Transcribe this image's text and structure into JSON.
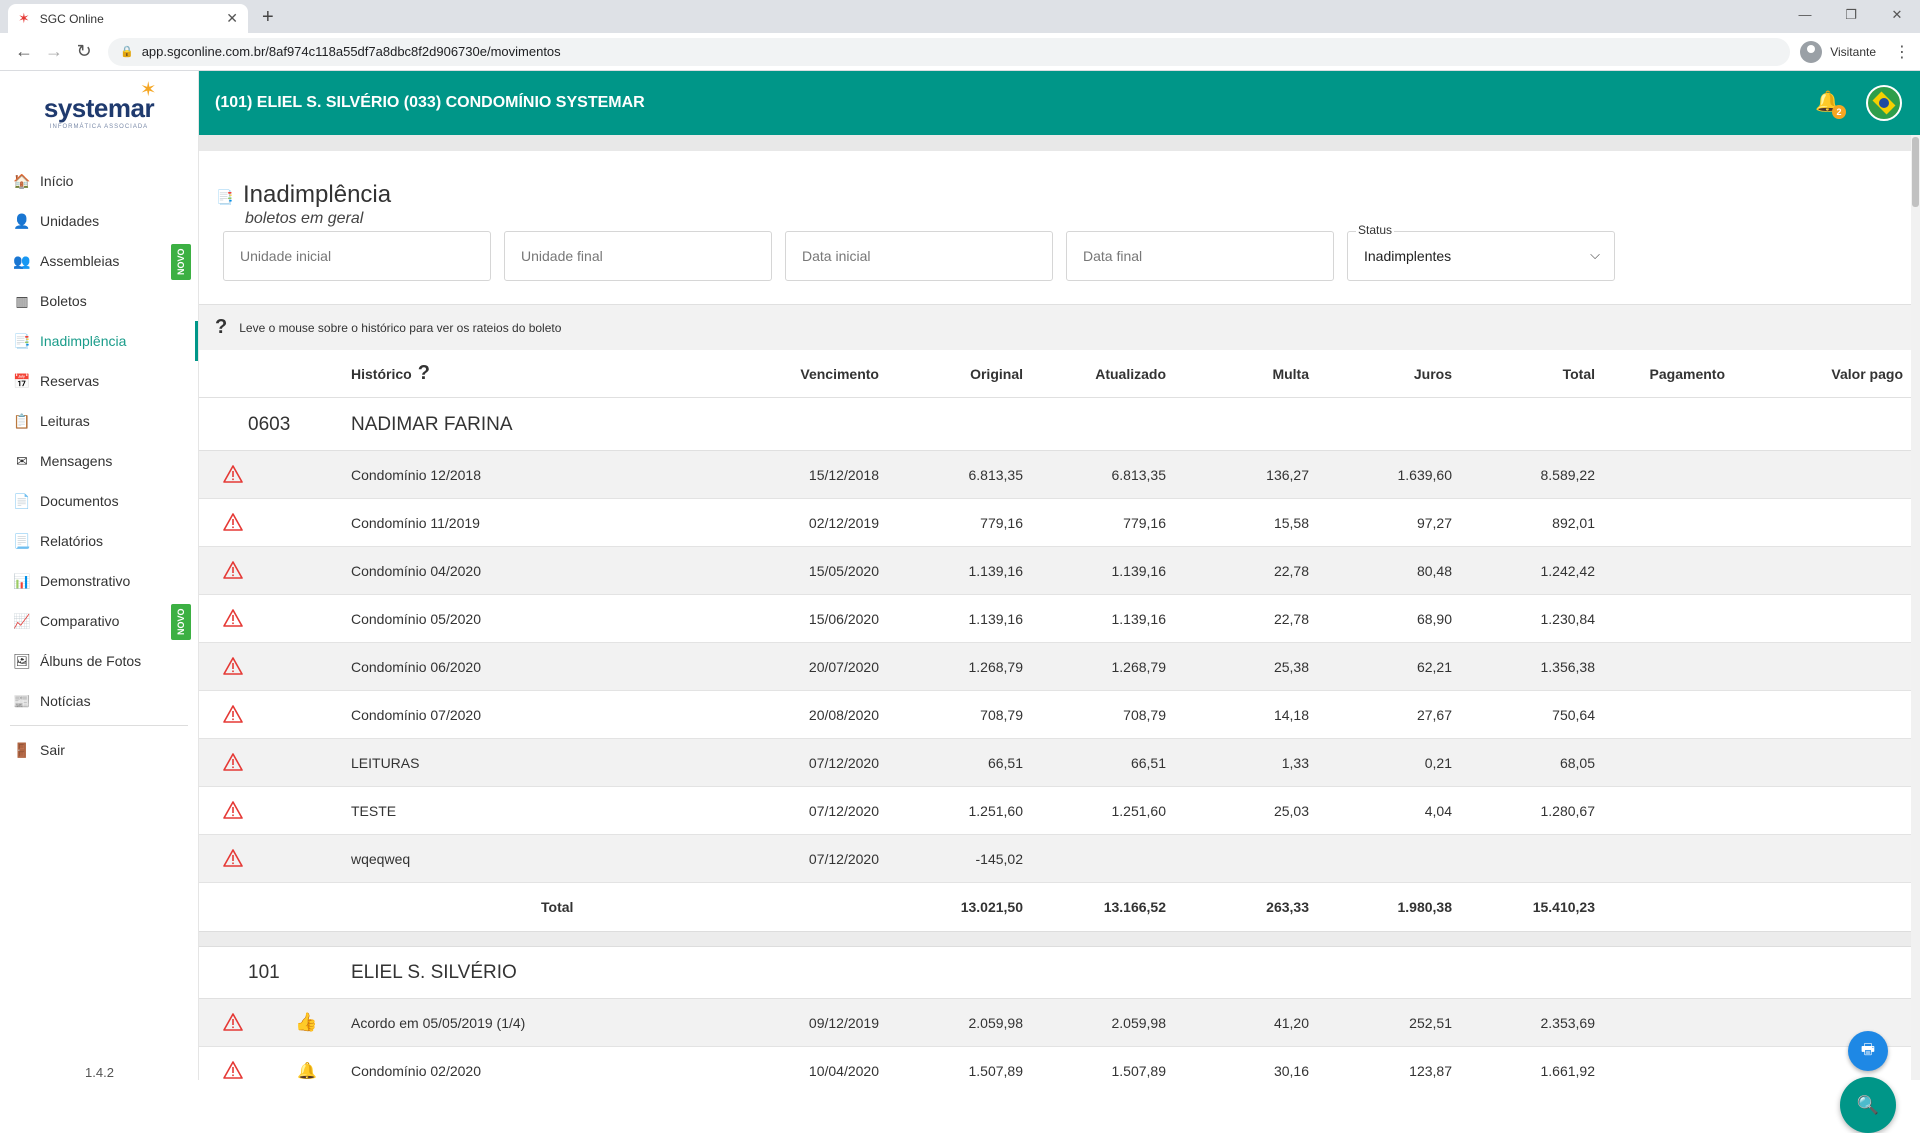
{
  "browser": {
    "tab_title": "SGC Online",
    "url": "app.sgconline.com.br/8af974c118a55df7a8dbc8f2d906730e/movimentos",
    "profile": "Visitante"
  },
  "logo": {
    "name": "systemar",
    "sub": "INFORMÁTICA ASSOCIADA"
  },
  "sidebar": {
    "items": [
      {
        "label": "Início",
        "icon": "home-icon"
      },
      {
        "label": "Unidades",
        "icon": "person-icon"
      },
      {
        "label": "Assembleias",
        "icon": "group-icon",
        "badge": "NOVO"
      },
      {
        "label": "Boletos",
        "icon": "barcode-icon"
      },
      {
        "label": "Inadimplência",
        "icon": "overdue-icon"
      },
      {
        "label": "Reservas",
        "icon": "calendar-icon"
      },
      {
        "label": "Leituras",
        "icon": "meter-icon"
      },
      {
        "label": "Mensagens",
        "icon": "message-icon"
      },
      {
        "label": "Documentos",
        "icon": "document-icon"
      },
      {
        "label": "Relatórios",
        "icon": "report-icon"
      },
      {
        "label": "Demonstrativo",
        "icon": "chart-icon"
      },
      {
        "label": "Comparativo",
        "icon": "compare-icon",
        "badge": "NOVO"
      },
      {
        "label": "Álbuns de Fotos",
        "icon": "photo-icon"
      },
      {
        "label": "Notícias",
        "icon": "news-icon"
      }
    ],
    "logout": "Sair",
    "version": "1.4.2"
  },
  "topbar": {
    "title": "(101) ELIEL S. SILVÉRIO  (033) CONDOMÍNIO SYSTEMAR",
    "notifications": "2"
  },
  "page": {
    "title": "Inadimplência",
    "subtitle": "boletos em geral"
  },
  "filters": {
    "unidade_inicial": "Unidade inicial",
    "unidade_final": "Unidade final",
    "data_inicial": "Data inicial",
    "data_final": "Data final",
    "status_label": "Status",
    "status_value": "Inadimplentes"
  },
  "hint": "Leve o mouse sobre o histórico para ver os rateios do boleto",
  "columns": {
    "historico": "Histórico",
    "vencimento": "Vencimento",
    "original": "Original",
    "atualizado": "Atualizado",
    "multa": "Multa",
    "juros": "Juros",
    "total": "Total",
    "pagamento": "Pagamento",
    "valor_pago": "Valor pago"
  },
  "groups": [
    {
      "code": "0603",
      "name": "NADIMAR FARINA",
      "rows": [
        {
          "historico": "Condomínio 12/2018",
          "vencimento": "15/12/2018",
          "original": "6.813,35",
          "atualizado": "6.813,35",
          "multa": "136,27",
          "juros": "1.639,60",
          "total": "8.589,22"
        },
        {
          "historico": "Condomínio 11/2019",
          "vencimento": "02/12/2019",
          "original": "779,16",
          "atualizado": "779,16",
          "multa": "15,58",
          "juros": "97,27",
          "total": "892,01"
        },
        {
          "historico": "Condomínio 04/2020",
          "vencimento": "15/05/2020",
          "original": "1.139,16",
          "atualizado": "1.139,16",
          "multa": "22,78",
          "juros": "80,48",
          "total": "1.242,42"
        },
        {
          "historico": "Condomínio 05/2020",
          "vencimento": "15/06/2020",
          "original": "1.139,16",
          "atualizado": "1.139,16",
          "multa": "22,78",
          "juros": "68,90",
          "total": "1.230,84"
        },
        {
          "historico": "Condomínio 06/2020",
          "vencimento": "20/07/2020",
          "original": "1.268,79",
          "atualizado": "1.268,79",
          "multa": "25,38",
          "juros": "62,21",
          "total": "1.356,38"
        },
        {
          "historico": "Condomínio 07/2020",
          "vencimento": "20/08/2020",
          "original": "708,79",
          "atualizado": "708,79",
          "multa": "14,18",
          "juros": "27,67",
          "total": "750,64"
        },
        {
          "historico": "LEITURAS",
          "vencimento": "07/12/2020",
          "original": "66,51",
          "atualizado": "66,51",
          "multa": "1,33",
          "juros": "0,21",
          "total": "68,05"
        },
        {
          "historico": "TESTE",
          "vencimento": "07/12/2020",
          "original": "1.251,60",
          "atualizado": "1.251,60",
          "multa": "25,03",
          "juros": "4,04",
          "total": "1.280,67"
        },
        {
          "historico": "wqeqweq",
          "vencimento": "07/12/2020",
          "original": "-145,02",
          "atualizado": "",
          "multa": "",
          "juros": "",
          "total": ""
        }
      ],
      "total": {
        "label": "Total",
        "original": "13.021,50",
        "atualizado": "13.166,52",
        "multa": "263,33",
        "juros": "1.980,38",
        "total": "15.410,23"
      }
    },
    {
      "code": "101",
      "name": "ELIEL S. SILVÉRIO",
      "rows": [
        {
          "historico": "Acordo em 05/05/2019 (1/4)",
          "vencimento": "09/12/2019",
          "original": "2.059,98",
          "atualizado": "2.059,98",
          "multa": "41,20",
          "juros": "252,51",
          "total": "2.353,69",
          "icon": "thumbs-up-icon"
        },
        {
          "historico": "Condomínio 02/2020",
          "vencimento": "10/04/2020",
          "original": "1.507,89",
          "atualizado": "1.507,89",
          "multa": "30,16",
          "juros": "123,87",
          "total": "1.661,92",
          "icon": "bell-icon"
        }
      ]
    }
  ],
  "colors": {
    "primary": "#009688",
    "accent": "#1e88e5",
    "warning": "#e53935"
  }
}
